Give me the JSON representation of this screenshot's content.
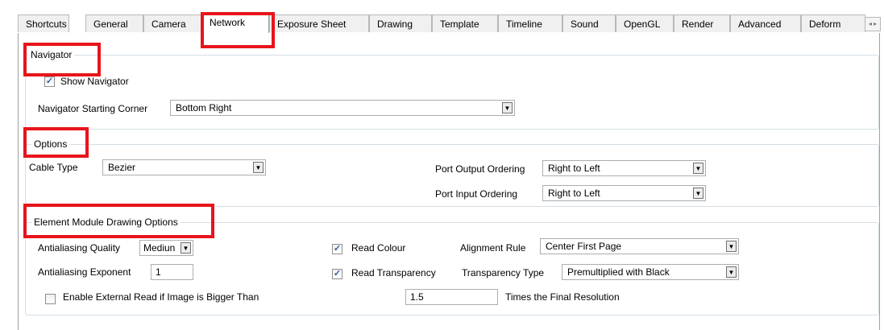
{
  "tabs": [
    {
      "label": "Shortcuts",
      "active": false
    },
    {
      "label": "General",
      "active": false
    },
    {
      "label": "Camera",
      "active": false
    },
    {
      "label": "Network",
      "active": true
    },
    {
      "label": "Exposure Sheet",
      "active": false
    },
    {
      "label": "Drawing",
      "active": false
    },
    {
      "label": "Template",
      "active": false
    },
    {
      "label": "Timeline",
      "active": false
    },
    {
      "label": "Sound",
      "active": false
    },
    {
      "label": "OpenGL",
      "active": false
    },
    {
      "label": "Render",
      "active": false
    },
    {
      "label": "Advanced",
      "active": false
    },
    {
      "label": "Deform",
      "active": false
    }
  ],
  "tab_scroll_glyphs": "◂ ▸",
  "navigator": {
    "title": "Navigator",
    "show_navigator": {
      "label": "Show Navigator",
      "checked": true
    },
    "starting_corner": {
      "label": "Navigator Starting Corner",
      "value": "Bottom Right"
    }
  },
  "options": {
    "title": "Options",
    "cable_type": {
      "label": "Cable Type",
      "value": "Bezier"
    },
    "port_output_ordering": {
      "label": "Port Output Ordering",
      "value": "Right to Left"
    },
    "port_input_ordering": {
      "label": "Port Input Ordering",
      "value": "Right to Left"
    }
  },
  "element_module": {
    "title": "Element Module Drawing Options",
    "antialiasing_quality": {
      "label": "Antialiasing Quality",
      "value": "Mediun"
    },
    "antialiasing_exponent": {
      "label": "Antialiasing Exponent",
      "value": "1"
    },
    "read_colour": {
      "label": "Read Colour",
      "checked": true
    },
    "read_transparency": {
      "label": "Read Transparency",
      "checked": true
    },
    "alignment_rule": {
      "label": "Alignment Rule",
      "value": "Center First Page"
    },
    "transparency_type": {
      "label": "Transparency Type",
      "value": "Premultiplied with Black"
    },
    "enable_external_read": {
      "label": "Enable External Read if Image is Bigger Than",
      "checked": false
    },
    "times_value": "1.5",
    "times_label": "Times the Final Resolution"
  },
  "colors": {
    "highlight": "#e8141b",
    "checkmark": "#3a57a6"
  },
  "icons": {
    "dropdown": "chevron-down-icon",
    "checkmark": "checkmark-icon"
  },
  "glyphs": {
    "dropdown_arrow": "▼",
    "check": "✓"
  }
}
